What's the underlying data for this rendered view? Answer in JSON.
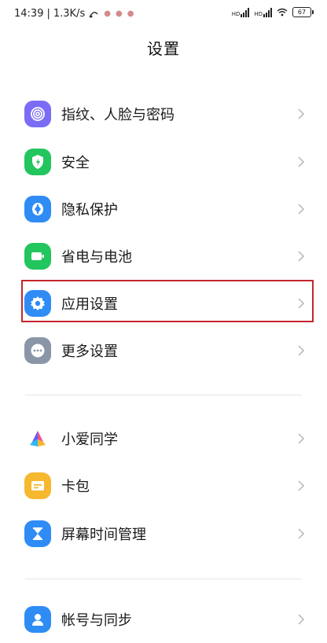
{
  "status_bar": {
    "time": "14:39",
    "speed": "1.3K/s",
    "sim1_label": "HD",
    "sim2_label": "HD",
    "battery": "67"
  },
  "page_title": "设置",
  "menu": {
    "items": [
      {
        "label": "指纹、人脸与密码",
        "icon": "fingerprint-icon",
        "color": "#7b6cf6"
      },
      {
        "label": "安全",
        "icon": "shield-icon",
        "color": "#22c55e"
      },
      {
        "label": "隐私保护",
        "icon": "privacy-icon",
        "color": "#2f8cf5"
      },
      {
        "label": "省电与电池",
        "icon": "battery-icon",
        "color": "#22c55e"
      },
      {
        "label": "应用设置",
        "icon": "gear-icon",
        "color": "#2f8cf5"
      },
      {
        "label": "更多设置",
        "icon": "more-icon",
        "color": "#8a96a8"
      }
    ],
    "items2": [
      {
        "label": "小爱同学",
        "icon": "xiaoai-icon",
        "color": "#ffffff"
      },
      {
        "label": "卡包",
        "icon": "wallet-icon",
        "color": "#f5b82e"
      },
      {
        "label": "屏幕时间管理",
        "icon": "hourglass-icon",
        "color": "#2f8cf5"
      }
    ],
    "items3": [
      {
        "label": "帐号与同步",
        "icon": "account-icon",
        "color": "#2f8cf5"
      }
    ]
  }
}
